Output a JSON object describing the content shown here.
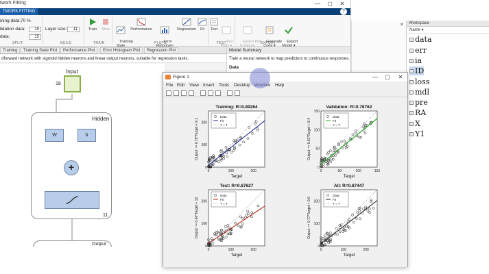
{
  "app": {
    "title": "twork Fitting",
    "window_controls": [
      "—",
      "▢",
      "✕"
    ],
    "tab": "TWORK FITTING",
    "help": "?"
  },
  "toolstrip": {
    "training_label": "ining data:",
    "training_value": "70 %",
    "validation_label": "lidation data:",
    "validation_value": "15",
    "test_label": "data:",
    "test_value": "15",
    "layer_size_label": "Layer size:",
    "layer_size_value": "11",
    "buttons": {
      "train": "Train",
      "stop": "Stop",
      "training_state": "Training\nState",
      "performance": "Performance",
      "error_histogram": "Error\nHistogram",
      "regression": "Regression",
      "fit": "Fit",
      "test": "Test",
      "test_plots": "Test\nPlots ▾",
      "export_plot": "Export Plot\nto Figure",
      "generate_code": "Generate\nCode ▾",
      "export_model": "Export\nModel ▾"
    },
    "sections": {
      "split": "SPLIT",
      "build": "BUILD",
      "train": "TRAIN",
      "plots": "PLOTS",
      "test": "TEST",
      "export": "EXPORT"
    }
  },
  "doc_tabs": [
    "Training",
    "Training State Plot",
    "Performance Plot",
    "Error Histogram Plot",
    "Regression Plot"
  ],
  "description": "dforward network with sigmoid hidden neurons and linear output neurons, suitable for regression tasks.",
  "diagram": {
    "input_label": "Input",
    "input_count": "18",
    "hidden_label": "Hidden",
    "w_label": "W",
    "b_label": "b",
    "plus": "+",
    "hidden_count": "11",
    "output_label": "Output"
  },
  "summary": {
    "header": "Model Summary",
    "text": "Train a neural network to map predictors to continuous responses.",
    "data_label": "Data"
  },
  "workspace": {
    "header": "Workspace",
    "column": "Name ▾",
    "items": [
      "data",
      "err",
      "ia",
      "ID",
      "loss",
      "mdl",
      "pre",
      "RA",
      "X",
      "Y1"
    ]
  },
  "figure": {
    "title": "Figure 1",
    "controls": [
      "—",
      "▢",
      "✕"
    ],
    "menu": [
      "File",
      "Edit",
      "View",
      "Insert",
      "Tools",
      "Desktop",
      "Window",
      "Help"
    ]
  },
  "chart_data": [
    {
      "type": "scatter",
      "title": "Training: R=0.89264",
      "xlabel": "Target",
      "ylabel": "Output ~= 0.79*Target + 9.1",
      "xlim": [
        0,
        250
      ],
      "ylim": [
        0,
        250
      ],
      "xticks": [
        0,
        100,
        200
      ],
      "yticks": [
        0,
        100,
        200
      ],
      "legend": [
        "Data",
        "Fit",
        "Y = T"
      ],
      "fit_color": "#1f2a8c",
      "fit": {
        "slope": 0.79,
        "intercept": 9.1
      }
    },
    {
      "type": "scatter",
      "title": "Validation: R=0.78762",
      "xlabel": "Target",
      "ylabel": "Output ~= 0.81*Target + 8.4",
      "xlim": [
        0,
        150
      ],
      "ylim": [
        0,
        150
      ],
      "xticks": [
        0,
        50,
        100,
        150
      ],
      "yticks": [
        0,
        50,
        100,
        150
      ],
      "legend": [
        "Data",
        "Fit",
        "Y = T"
      ],
      "fit_color": "#1aa51a",
      "fit": {
        "slope": 0.81,
        "intercept": 8.4
      }
    },
    {
      "type": "scatter",
      "title": "Test: R=0.87627",
      "xlabel": "Target",
      "ylabel": "Output ~= 0.66*Target + 12",
      "xlim": [
        0,
        250
      ],
      "ylim": [
        0,
        250
      ],
      "xticks": [
        0,
        100,
        200
      ],
      "yticks": [
        0,
        100,
        200
      ],
      "legend": [
        "Data",
        "Fit",
        "Y = T"
      ],
      "fit_color": "#b02a1a",
      "fit": {
        "slope": 0.66,
        "intercept": 12
      }
    },
    {
      "type": "scatter",
      "title": "All: R=0.87447",
      "xlabel": "Target",
      "ylabel": "Output ~= 0.77*Target + 9.6",
      "xlim": [
        0,
        250
      ],
      "ylim": [
        0,
        250
      ],
      "xticks": [
        0,
        100,
        200
      ],
      "yticks": [
        0,
        100,
        200
      ],
      "legend": [
        "Data",
        "Fit",
        "Y = T"
      ],
      "fit_color": "#222222",
      "fit": {
        "slope": 0.77,
        "intercept": 9.6
      }
    }
  ]
}
